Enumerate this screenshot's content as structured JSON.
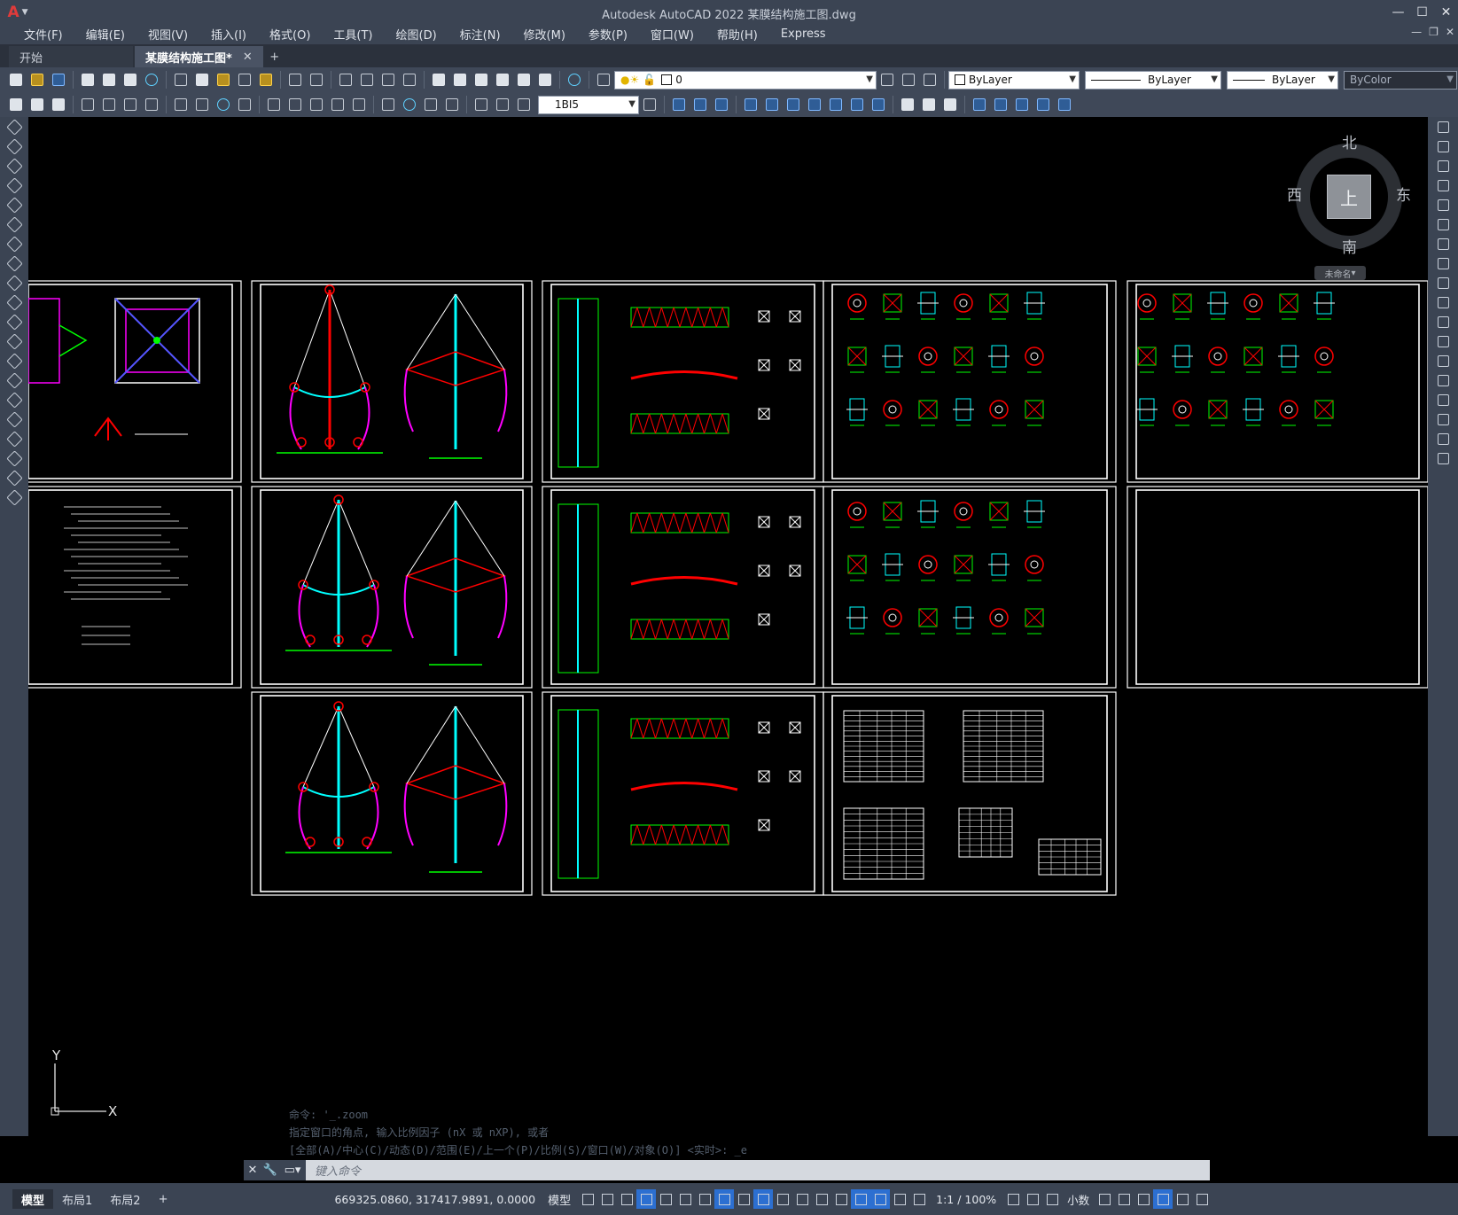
{
  "app": {
    "title": "Autodesk AutoCAD 2022    某膜结构施工图.dwg",
    "logo": "A"
  },
  "menu": [
    "文件(F)",
    "编辑(E)",
    "视图(V)",
    "插入(I)",
    "格式(O)",
    "工具(T)",
    "绘图(D)",
    "标注(N)",
    "修改(M)",
    "参数(P)",
    "窗口(W)",
    "帮助(H)",
    "Express"
  ],
  "tabs": {
    "start": "开始",
    "drawing": "某膜结构施工图*"
  },
  "toolbar": {
    "layer_value": "0",
    "color_value": "ByLayer",
    "linetype_value": "ByLayer",
    "lineweight_value": "ByLayer",
    "plotstyle_value": "ByColor",
    "dimstyle_value": "1BI5"
  },
  "viewcube": {
    "north": "北",
    "south": "南",
    "east": "东",
    "west": "西",
    "face": "上",
    "wcs": "未命名"
  },
  "ucs": {
    "x": "X",
    "y": "Y"
  },
  "command": {
    "history": [
      "命令: '_.zoom",
      "指定窗口的角点, 输入比例因子 (nX 或 nXP), 或者",
      "[全部(A)/中心(C)/动态(D)/范围(E)/上一个(P)/比例(S)/窗口(W)/对象(O)] <实时>: _e"
    ],
    "placeholder": "键入命令"
  },
  "status": {
    "layout_tabs": [
      "模型",
      "布局1",
      "布局2"
    ],
    "coords": "669325.0860, 317417.9891, 0.0000",
    "model": "模型",
    "scale": "1:1 / 100%",
    "units": "小数"
  },
  "colors": {
    "background": "#000000",
    "chrome": "#3b4453",
    "frame": "#ffffff",
    "green": "#00ff00",
    "cyan": "#00ffff",
    "red": "#ff0000",
    "magenta": "#ff00ff"
  }
}
